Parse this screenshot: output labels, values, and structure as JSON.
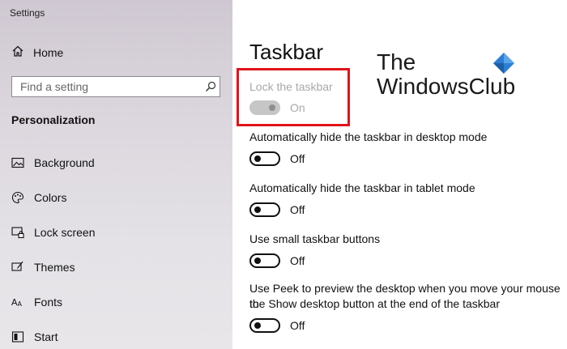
{
  "window": {
    "title": "Settings"
  },
  "sidebar": {
    "home_label": "Home",
    "search_placeholder": "Find a setting",
    "section_title": "Personalization",
    "items": [
      {
        "label": "Background",
        "icon": "image-icon"
      },
      {
        "label": "Colors",
        "icon": "palette-icon"
      },
      {
        "label": "Lock screen",
        "icon": "lock-screen-icon"
      },
      {
        "label": "Themes",
        "icon": "themes-brush-icon"
      },
      {
        "label": "Fonts",
        "icon": "fonts-icon"
      },
      {
        "label": "Start",
        "icon": "start-icon"
      }
    ]
  },
  "main": {
    "title": "Taskbar",
    "settings": [
      {
        "label": "Lock the taskbar",
        "state": "On",
        "enabled": false
      },
      {
        "label": "Automatically hide the taskbar in desktop mode",
        "state": "Off",
        "enabled": true
      },
      {
        "label": "Automatically hide the taskbar in tablet mode",
        "state": "Off",
        "enabled": true
      },
      {
        "label": "Use small taskbar buttons",
        "state": "Off",
        "enabled": true
      },
      {
        "label_line1": "Use Peek to preview the desktop when you move your mouse to",
        "label_line2": "the Show desktop button at the end of the taskbar",
        "state": "Off",
        "enabled": true
      }
    ]
  },
  "watermark": {
    "line1": "The",
    "line2": "WindowsClub",
    "logo_color": "#2d7fd4"
  },
  "colors": {
    "highlight_border": "#e0141a",
    "disabled_text": "#a8a8a8"
  }
}
